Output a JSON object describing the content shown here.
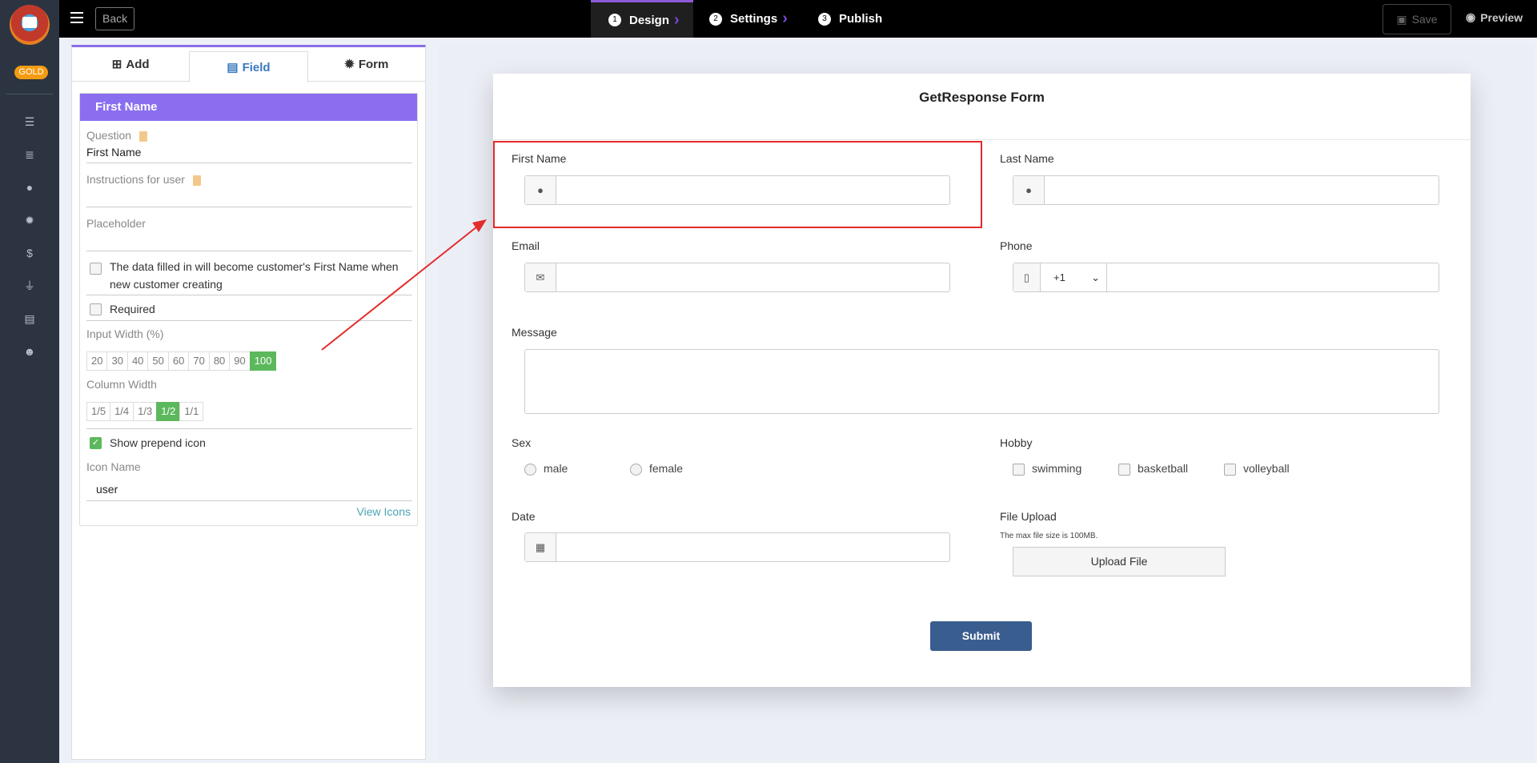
{
  "rail": {
    "badge": "GOLD",
    "icons": [
      "list-icon",
      "tasks-icon",
      "user-icon",
      "gear-icon",
      "dollar-icon",
      "plug-icon",
      "file-icon",
      "smile-icon"
    ]
  },
  "topbar": {
    "back_label": "Back",
    "steps": [
      {
        "num": "1",
        "label": "Design"
      },
      {
        "num": "2",
        "label": "Settings"
      },
      {
        "num": "3",
        "label": "Publish"
      }
    ],
    "save_label": "Save",
    "preview_label": "Preview"
  },
  "panel": {
    "tabs": [
      {
        "label": "Add",
        "icon": "plus-square-icon"
      },
      {
        "label": "Field",
        "icon": "list-alt-icon"
      },
      {
        "label": "Form",
        "icon": "gear-icon"
      }
    ],
    "field_title": "First Name",
    "question_label": "Question",
    "question_value": "First Name",
    "instructions_label": "Instructions for user",
    "placeholder_label": "Placeholder",
    "customer_checkbox_text": "The data filled in will become customer's First Name when new customer creating",
    "required_label": "Required",
    "input_width_label": "Input Width (%)",
    "input_widths": [
      "20",
      "30",
      "40",
      "50",
      "60",
      "70",
      "80",
      "90",
      "100"
    ],
    "input_width_selected": "100",
    "column_width_label": "Column Width",
    "column_widths": [
      "1/5",
      "1/4",
      "1/3",
      "1/2",
      "1/1"
    ],
    "column_width_selected": "1/2",
    "show_prepend_label": "Show prepend icon",
    "icon_name_label": "Icon Name",
    "icon_name_value": "user",
    "view_icons_label": "View Icons"
  },
  "form": {
    "title": "GetResponse Form",
    "first_name_label": "First Name",
    "last_name_label": "Last Name",
    "email_label": "Email",
    "phone_label": "Phone",
    "phone_code": "+1",
    "message_label": "Message",
    "sex_label": "Sex",
    "sex_options": [
      "male",
      "female"
    ],
    "hobby_label": "Hobby",
    "hobby_options": [
      "swimming",
      "basketball",
      "volleyball"
    ],
    "date_label": "Date",
    "file_upload_label": "File Upload",
    "file_note": "The max file size is 100MB.",
    "upload_label": "Upload File",
    "submit_label": "Submit"
  },
  "colors": {
    "accent_purple": "#8b6ef0",
    "selected_green": "#5cb85c",
    "submit_blue": "#3a5d8f",
    "highlight_red": "#e32b2b"
  }
}
